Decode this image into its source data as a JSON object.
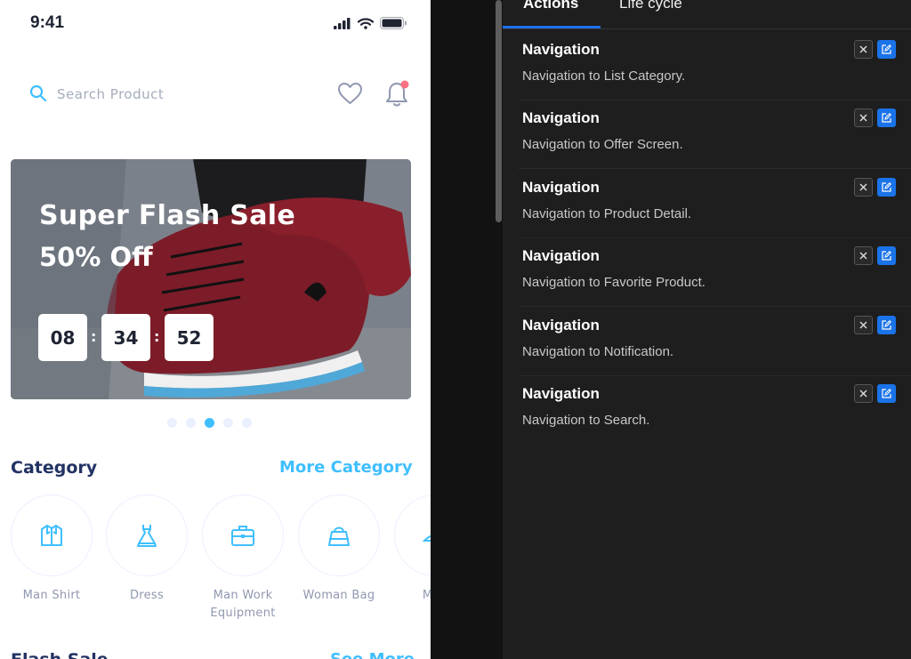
{
  "phone": {
    "status_time": "9:41",
    "search_placeholder": "Search Product",
    "banner": {
      "title": "Super Flash Sale",
      "subtitle": "50% Off",
      "timer": [
        "08",
        "34",
        "52"
      ]
    },
    "carousel_active_index": 2,
    "carousel_count": 5,
    "category_title": "Category",
    "category_link": "More Category",
    "categories": [
      {
        "label": "Man Shirt",
        "icon": "shirt-icon"
      },
      {
        "label": "Dress",
        "icon": "dress-icon"
      },
      {
        "label": "Man Work Equipment",
        "icon": "briefcase-icon"
      },
      {
        "label": "Woman Bag",
        "icon": "bag-icon"
      },
      {
        "label": "Man",
        "icon": "shoe-icon"
      }
    ],
    "flash_title": "Flash Sale",
    "flash_link": "See More",
    "accent_color": "#40bfff",
    "notification_dot_color": "#fb7181"
  },
  "panel": {
    "tabs": [
      "Actions",
      "Life cycle"
    ],
    "active_tab": "Actions",
    "actions": [
      {
        "title": "Navigation",
        "description": "Navigation to List Category."
      },
      {
        "title": "Navigation",
        "description": "Navigation to Offer Screen."
      },
      {
        "title": "Navigation",
        "description": "Navigation to Product Detail."
      },
      {
        "title": "Navigation",
        "description": "Navigation to Favorite Product."
      },
      {
        "title": "Navigation",
        "description": "Navigation to Notification."
      },
      {
        "title": "Navigation",
        "description": "Navigation to Search."
      }
    ],
    "accent_color": "#1a73e8"
  }
}
